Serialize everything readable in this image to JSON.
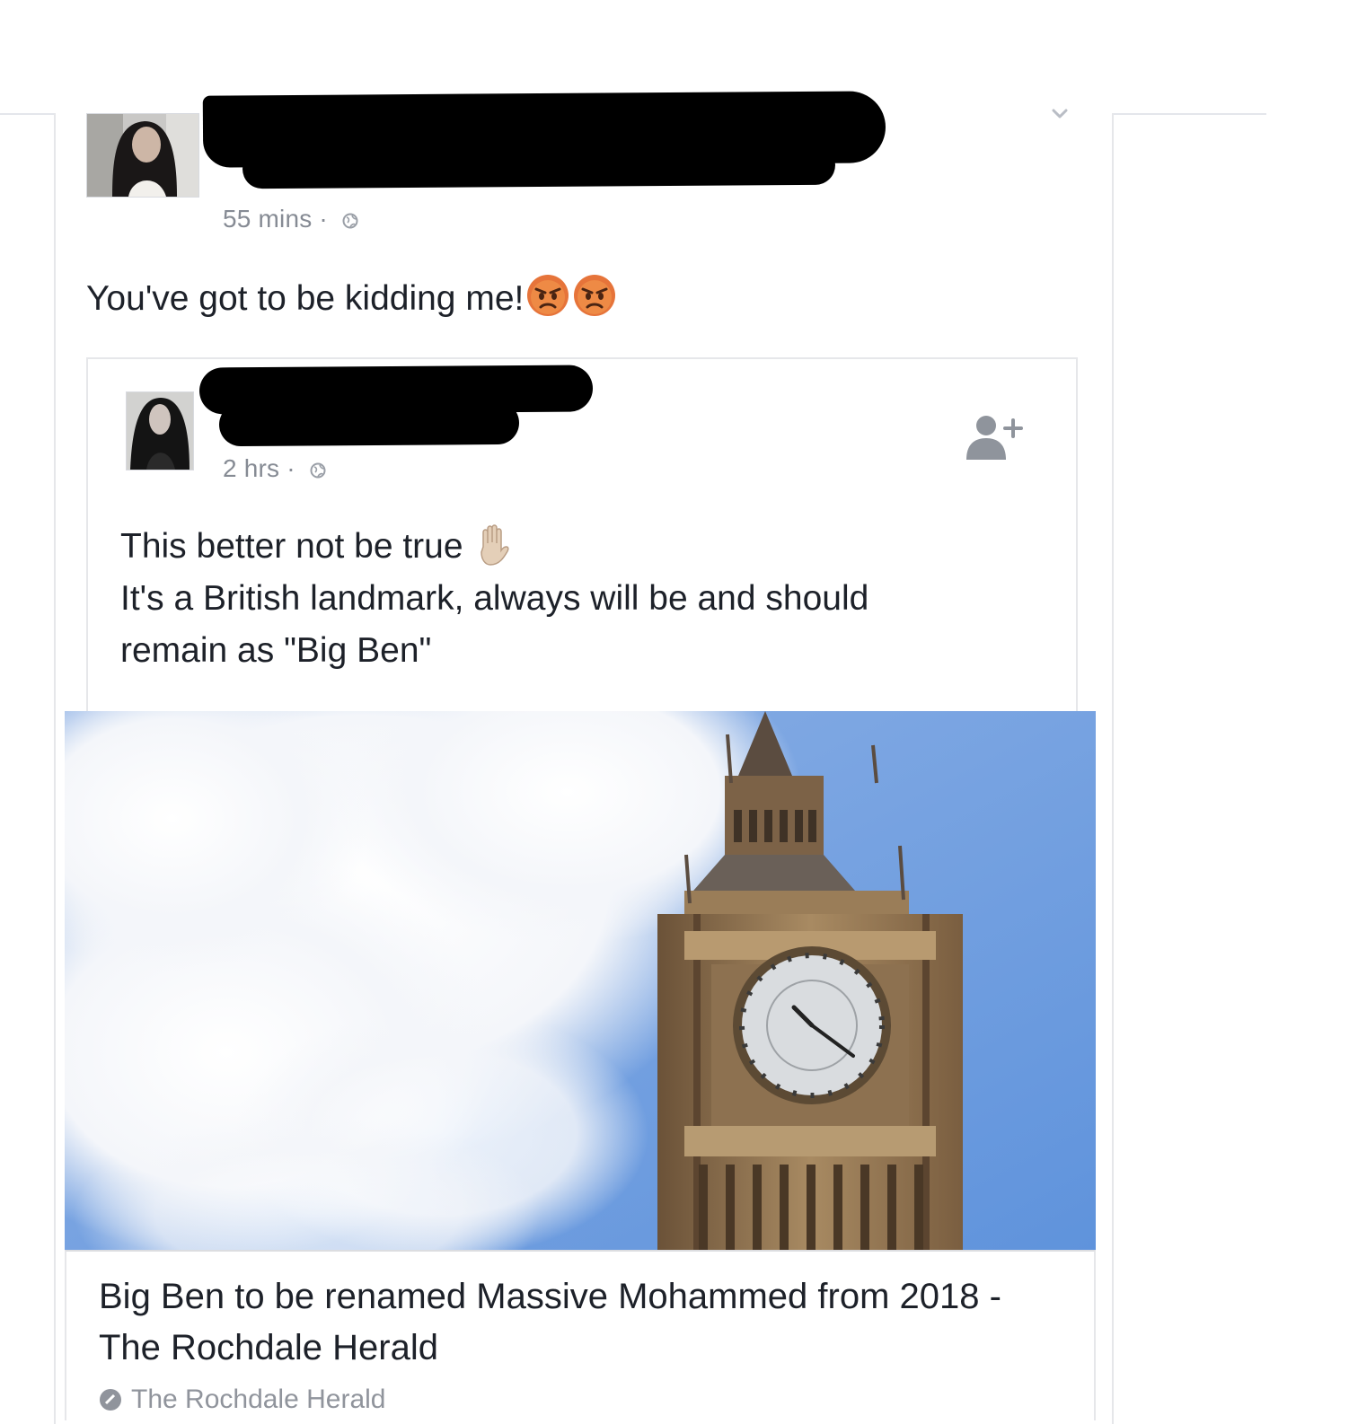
{
  "post": {
    "timestamp": "55 mins",
    "separator": " · ",
    "privacy_icon": "globe-icon",
    "text": "You've got to be kidding me!",
    "emojis": [
      "angry-face-icon",
      "angry-face-icon"
    ]
  },
  "shared_post": {
    "timestamp": "2 hrs",
    "separator": " · ",
    "privacy_icon": "globe-icon",
    "text_line1": "This better not be true",
    "text_emoji": "raised-hand-icon",
    "text_line2": "It's a British landmark, always will be and should",
    "text_line3": "remain as \"Big Ben\"",
    "add_friend_icon": "add-friend-icon"
  },
  "link": {
    "title": "Big Ben to be renamed Massive Mohammed from 2018 - The Rochdale Herald",
    "source": "The Rochdale Herald"
  },
  "colors": {
    "text": "#1d2129",
    "meta": "#868b94",
    "border": "#e6e7ea",
    "sky": "#6f9fe0"
  }
}
